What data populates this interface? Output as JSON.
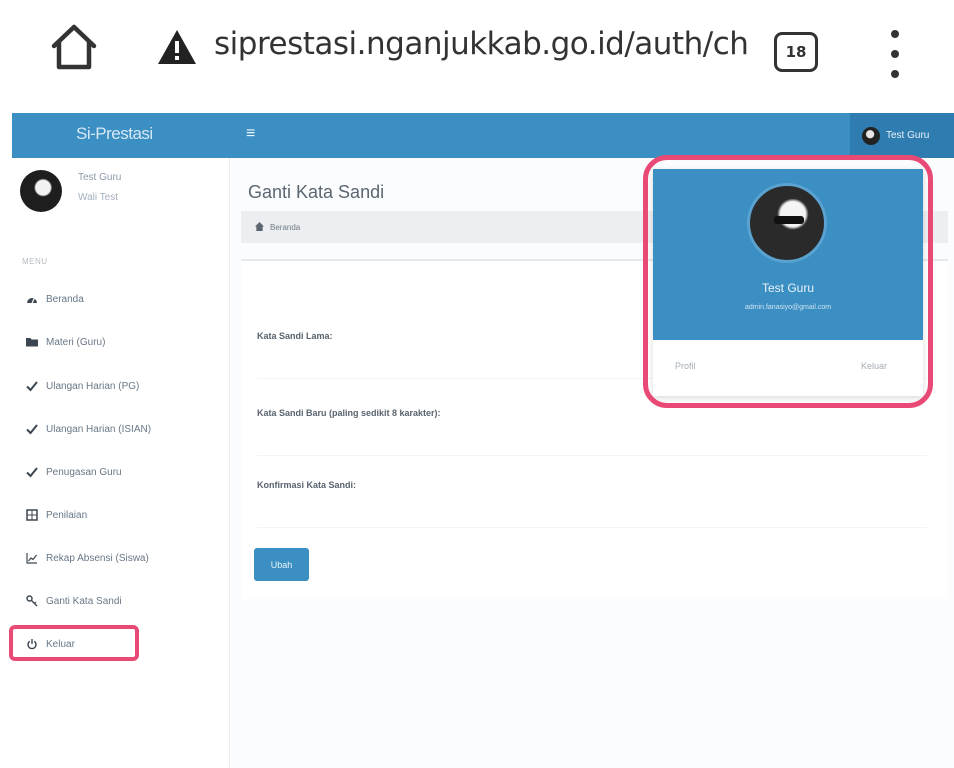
{
  "browser": {
    "url": "siprestasi.nganjukkab.go.id/auth/ch",
    "tab_count": "18"
  },
  "app": {
    "brand": "Si-Prestasi",
    "hamburger": "≡",
    "nav_user_name": "Test Guru"
  },
  "sidebar": {
    "user_name": "Test Guru",
    "user_role": "Wali Test",
    "menu_header": "MENU",
    "items": [
      {
        "label": "Beranda",
        "icon": "dashboard-icon"
      },
      {
        "label": "Materi (Guru)",
        "icon": "folder-icon"
      },
      {
        "label": "Ulangan Harian (PG)",
        "icon": "check-icon"
      },
      {
        "label": "Ulangan Harian (ISIAN)",
        "icon": "check-icon"
      },
      {
        "label": "Penugasan Guru",
        "icon": "check-icon"
      },
      {
        "label": "Penilaian",
        "icon": "grid-icon"
      },
      {
        "label": "Rekap Absensi (Siswa)",
        "icon": "line-chart-icon"
      },
      {
        "label": "Ganti Kata Sandi",
        "icon": "key-icon"
      },
      {
        "label": "Keluar",
        "icon": "power-icon"
      }
    ]
  },
  "main": {
    "title": "Ganti Kata Sandi",
    "breadcrumb": "Beranda",
    "fields": [
      {
        "label": "Kata Sandi Lama:",
        "value": ""
      },
      {
        "label": "Kata Sandi Baru (paling sedikit 8 karakter):",
        "value": ""
      },
      {
        "label": "Konfirmasi Kata Sandi:",
        "value": ""
      }
    ],
    "submit_label": "Ubah"
  },
  "dropdown": {
    "name": "Test Guru",
    "email": "admin.fanasiyo@gmail.com",
    "profile_label": "Profil",
    "logout_label": "Keluar"
  },
  "colors": {
    "primary": "#3b8fc3",
    "highlight": "#e84a75"
  }
}
